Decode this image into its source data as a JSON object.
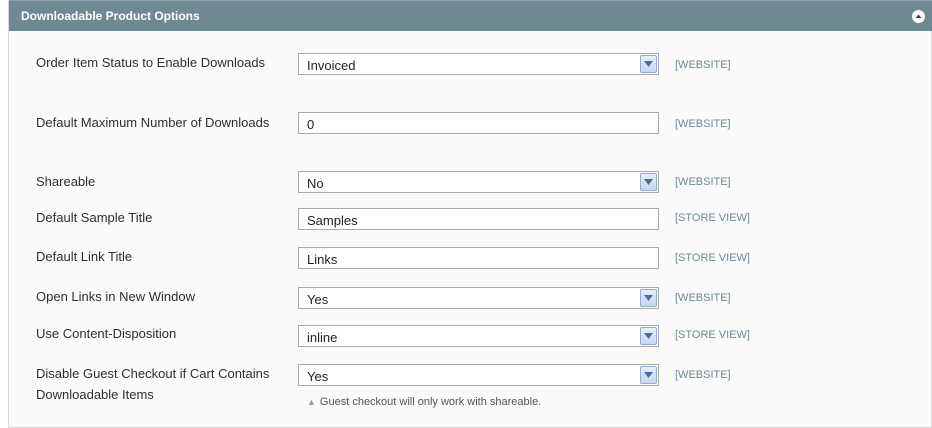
{
  "section": {
    "title": "Downloadable Product Options",
    "collapse_icon": "chevron-up-icon"
  },
  "rows": [
    {
      "label": "Order Item Status to Enable Downloads",
      "type": "select",
      "value": "Invoiced",
      "scope": "[WEBSITE]"
    },
    {
      "label": "Default Maximum Number of Downloads",
      "type": "text",
      "value": "0",
      "scope": "[WEBSITE]"
    },
    {
      "label": "Shareable",
      "type": "select",
      "value": "No",
      "scope": "[WEBSITE]"
    },
    {
      "label": "Default Sample Title",
      "type": "text",
      "value": "Samples",
      "scope": "[STORE VIEW]"
    },
    {
      "label": "Default Link Title",
      "type": "text",
      "value": "Links",
      "scope": "[STORE VIEW]"
    },
    {
      "label": "Open Links in New Window",
      "type": "select",
      "value": "Yes",
      "scope": "[WEBSITE]"
    },
    {
      "label": "Use Content-Disposition",
      "type": "select",
      "value": "inline",
      "scope": "[STORE VIEW]"
    },
    {
      "label": "Disable Guest Checkout if Cart Contains Downloadable Items",
      "type": "select",
      "value": "Yes",
      "scope": "[WEBSITE]"
    }
  ],
  "guest_checkout_hint": "Guest checkout will only work with shareable.",
  "colors": {
    "header": "#6f8992",
    "scope_text": "#6f8992",
    "select_button": "#c7d5ee"
  }
}
